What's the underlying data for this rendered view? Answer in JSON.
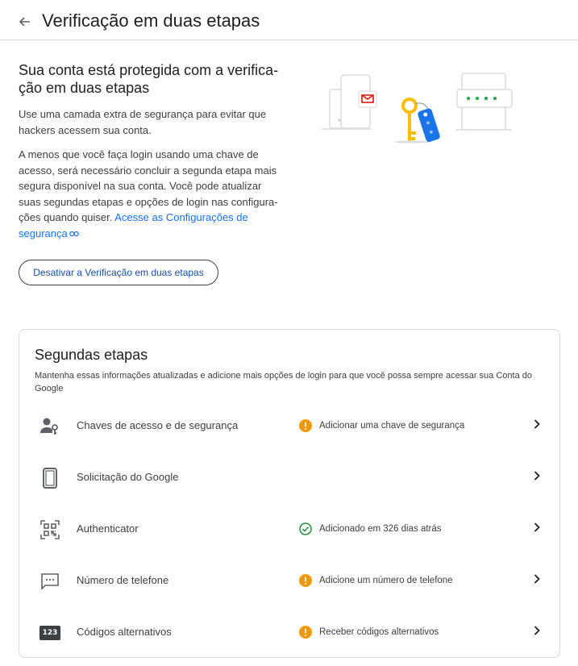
{
  "header": {
    "title": "Verificação em duas etapas"
  },
  "hero": {
    "heading": "Sua conta está protegida com a verifica-ção em duas etapas",
    "para1": "Use uma camada extra de segurança para evitar que hackers acessem sua conta.",
    "para2_text": "A menos que você faça login usando uma chave de acesso, será necessário concluir a segunda etapa mais segura disponível na sua conta. Você pode atualizar suas segundas etapas e opções de login nas configura-ções quando quiser. ",
    "settings_link": "Acesse as Configurações de segurança",
    "disable_button": "Desativar a Verificação em duas etapas"
  },
  "second_steps": {
    "title": "Segundas etapas",
    "subtitle": "Mantenha essas informações atualizadas e adicione mais opções de login para que você possa sempre acessar sua Conta do Google",
    "items": [
      {
        "label": "Chaves de acesso e de segurança",
        "icon": "passkey-icon",
        "status_text": "Adicionar uma chave de segurança",
        "status_type": "warning"
      },
      {
        "label": "Solicitação do Google",
        "icon": "phone-device-icon",
        "status_text": "",
        "status_type": "none"
      },
      {
        "label": "Authenticator",
        "icon": "qr-code-icon",
        "status_text": "Adicionado em 326 dias atrás",
        "status_type": "success"
      },
      {
        "label": "Número de telefone",
        "icon": "message-icon",
        "status_text": "Adicione um número de telefone",
        "status_type": "warning"
      },
      {
        "label": "Códigos alternativos",
        "icon": "backup-codes-icon",
        "icon_text": "123",
        "status_text": "Receber códigos alternativos",
        "status_type": "warning"
      }
    ]
  },
  "colors": {
    "warning": "#f29900",
    "success": "#1e8e3e",
    "link": "#1a73e8",
    "key_yellow": "#fbbc04",
    "key_blue": "#1a73e8",
    "envelope_red": "#d93025",
    "dots_green": "#34a853"
  }
}
